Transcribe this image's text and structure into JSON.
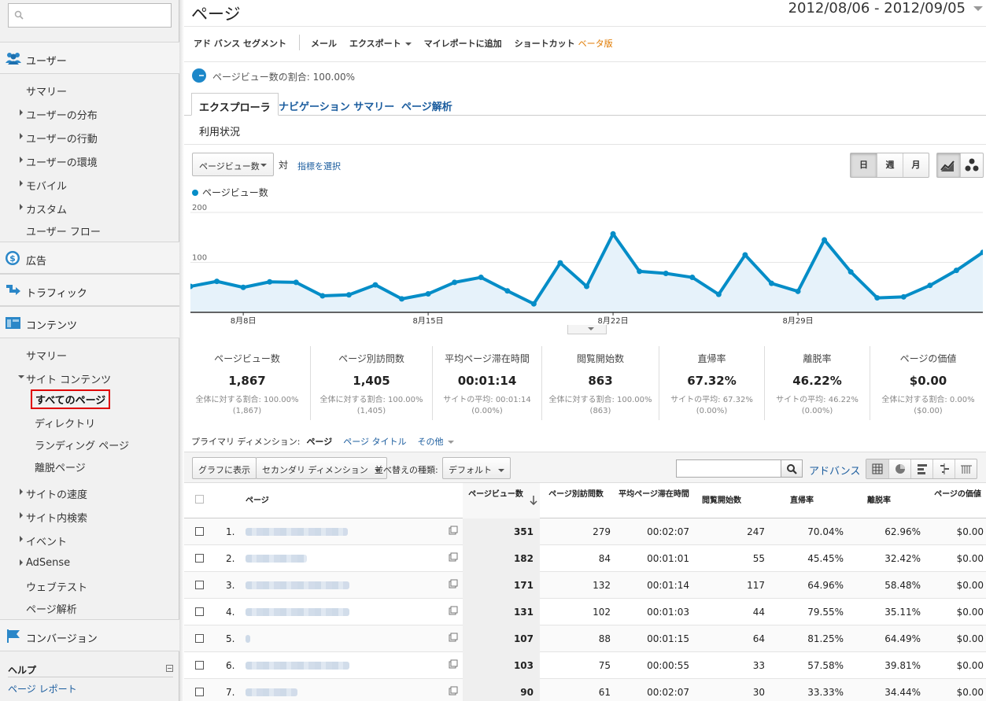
{
  "sidebar": {
    "search_placeholder": "",
    "sections": {
      "users": "ユーザー",
      "ads": "広告",
      "traffic": "トラフィック",
      "content": "コンテンツ",
      "conversions": "コンバージョン"
    },
    "users_items": [
      "サマリー",
      "ユーザーの分布",
      "ユーザーの行動",
      "ユーザーの環境",
      "モバイル",
      "カスタム",
      "ユーザー フロー"
    ],
    "content_items": [
      "サマリー",
      "サイト コンテンツ",
      "すべてのページ",
      "ディレクトリ",
      "ランディング ページ",
      "離脱ページ",
      "サイトの速度",
      "サイト内検索",
      "イベント",
      "AdSense",
      "ウェブテスト",
      "ページ解析"
    ],
    "help_title": "ヘルプ",
    "help_toggle": "−",
    "help_link": "ページ レポート"
  },
  "header": {
    "title": "ページ",
    "date_range": "2012/08/06 - 2012/09/05"
  },
  "toolbar": {
    "advanced_segments": "アド バンス セグメント",
    "email": "メール",
    "export": "エクスポート",
    "add_dashboard": "マイレポートに追加",
    "shortcut": "ショートカット",
    "beta": "ベータ版"
  },
  "segment": {
    "label": "ページビュー数の割合: 100.00%"
  },
  "tabs": [
    "エクスプローラ",
    "ナビゲーション サマリー",
    "ページ解析"
  ],
  "subtab": "利用状況",
  "chart_controls": {
    "metric": "ページビュー数",
    "vs": "対",
    "select_metric": "指標を選択",
    "granularity": [
      "日",
      "週",
      "月"
    ]
  },
  "chart_data": {
    "type": "line",
    "series": [
      {
        "name": "ページビュー数",
        "color": "#058dc7",
        "values": [
          52,
          62,
          50,
          61,
          60,
          33,
          35,
          55,
          27,
          37,
          60,
          70,
          43,
          17,
          99,
          52,
          157,
          82,
          78,
          70,
          36,
          115,
          58,
          42,
          145,
          81,
          29,
          31,
          54,
          84,
          120
        ]
      }
    ],
    "x_tick_labels": [
      "8月8日",
      "8月15日",
      "8月22日",
      "8月29日"
    ],
    "y_tick_labels": [
      "200",
      "100"
    ],
    "ylim": [
      0,
      200
    ],
    "grid": true
  },
  "scorecards": [
    {
      "title": "ページビュー数",
      "value": "1,867",
      "sub": "全体に対する割合: 100.00%",
      "sub2": "(1,867)"
    },
    {
      "title": "ページ別訪問数",
      "value": "1,405",
      "sub": "全体に対する割合: 100.00%",
      "sub2": "(1,405)"
    },
    {
      "title": "平均ページ滞在時間",
      "value": "00:01:14",
      "sub": "サイトの平均: 00:01:14",
      "sub2": "(0.00%)"
    },
    {
      "title": "閲覧開始数",
      "value": "863",
      "sub": "全体に対する割合: 100.00%",
      "sub2": "(863)"
    },
    {
      "title": "直帰率",
      "value": "67.32%",
      "sub": "サイトの平均: 67.32%",
      "sub2": "(0.00%)"
    },
    {
      "title": "離脱率",
      "value": "46.22%",
      "sub": "サイトの平均: 46.22%",
      "sub2": "(0.00%)"
    },
    {
      "title": "ページの価値",
      "value": "$0.00",
      "sub": "全体に対する割合: 0.00%",
      "sub2": "($0.00)"
    }
  ],
  "dimension": {
    "label": "プライマリ ディメンション:",
    "current": "ページ",
    "page_title": "ページ タイトル",
    "other": "その他"
  },
  "table_controls": {
    "plot_rows": "グラフに表示",
    "secondary_dim": "セカンダリ ディメンション",
    "sort_label": "並べ替えの種類:",
    "sort_value": "デフォルト",
    "advanced": "アドバンス"
  },
  "table": {
    "headers": {
      "page": "ページ",
      "pageviews": "ページビュー数",
      "unique": "ページ別訪問数",
      "avg_time": "平均ページ滞在時間",
      "entrances": "閲覧開始数",
      "bounce": "直帰率",
      "exit": "離脱率",
      "value": "ページの価値"
    },
    "rows": [
      {
        "num": "1.",
        "pv": "351",
        "uv": "279",
        "time": "00:02:07",
        "ent": "247",
        "bounce": "70.04%",
        "exit": "62.96%",
        "val": "$0.00"
      },
      {
        "num": "2.",
        "pv": "182",
        "uv": "84",
        "time": "00:01:01",
        "ent": "55",
        "bounce": "45.45%",
        "exit": "32.42%",
        "val": "$0.00"
      },
      {
        "num": "3.",
        "pv": "171",
        "uv": "132",
        "time": "00:01:14",
        "ent": "117",
        "bounce": "64.96%",
        "exit": "58.48%",
        "val": "$0.00"
      },
      {
        "num": "4.",
        "pv": "131",
        "uv": "102",
        "time": "00:01:03",
        "ent": "44",
        "bounce": "79.55%",
        "exit": "35.11%",
        "val": "$0.00"
      },
      {
        "num": "5.",
        "pv": "107",
        "uv": "88",
        "time": "00:01:15",
        "ent": "64",
        "bounce": "81.25%",
        "exit": "64.49%",
        "val": "$0.00"
      },
      {
        "num": "6.",
        "pv": "103",
        "uv": "75",
        "time": "00:00:55",
        "ent": "33",
        "bounce": "57.58%",
        "exit": "39.81%",
        "val": "$0.00"
      },
      {
        "num": "7.",
        "pv": "90",
        "uv": "61",
        "time": "00:02:07",
        "ent": "30",
        "bounce": "33.33%",
        "exit": "34.44%",
        "val": "$0.00"
      }
    ]
  }
}
